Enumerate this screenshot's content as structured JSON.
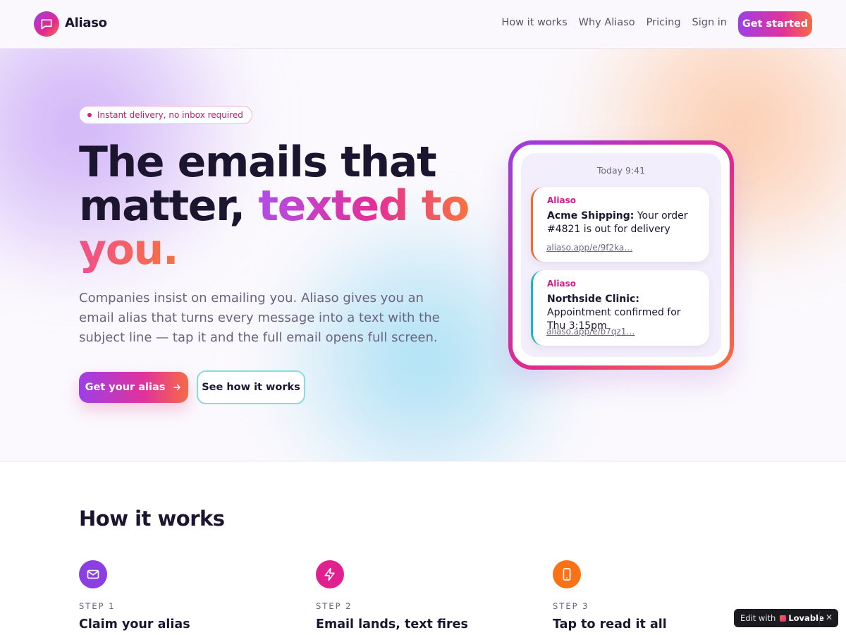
{
  "header": {
    "brand": "Aliaso",
    "nav": [
      "How it works",
      "Why Aliaso",
      "Pricing",
      "Sign in"
    ],
    "cta": "Get started"
  },
  "hero": {
    "pill": "Instant delivery, no inbox required",
    "headline_part1": "The emails that matter,",
    "headline_part2": "texted to",
    "headline_part3": "you.",
    "subtitle": "Companies insist on emailing you. Aliaso gives you an email alias that turns every message into a text with the subject line — tap it and the full email opens full screen.",
    "primary_button": "Get your alias",
    "secondary_button": "See how it works"
  },
  "phone": {
    "time": "Today 9:41",
    "messages": [
      {
        "from": "Aliaso",
        "sender": "Acme Shipping:",
        "text": "Your order #4821 is out for delivery",
        "link": "aliaso.app/e/9f2ka…",
        "accent": "#f06b33"
      },
      {
        "from": "Aliaso",
        "sender": "Northside Clinic:",
        "text": "Appointment confirmed for Thu 3:15pm",
        "link": "aliaso.app/e/b7qz1…",
        "accent": "#1fb3c4"
      }
    ]
  },
  "how_it_works": {
    "title": "How it works",
    "steps": [
      {
        "label": "STEP 1",
        "title": "Claim your alias",
        "icon": "mail-icon",
        "color": "#8b3fe0"
      },
      {
        "label": "STEP 2",
        "title": "Email lands, text fires",
        "icon": "lightning-icon",
        "color": "#e0208f"
      },
      {
        "label": "STEP 3",
        "title": "Tap to read it all",
        "icon": "phone-icon",
        "color": "#f97316"
      }
    ]
  },
  "badge": {
    "edit_with": "Edit with",
    "brand": "Lovable",
    "close": "✕"
  }
}
